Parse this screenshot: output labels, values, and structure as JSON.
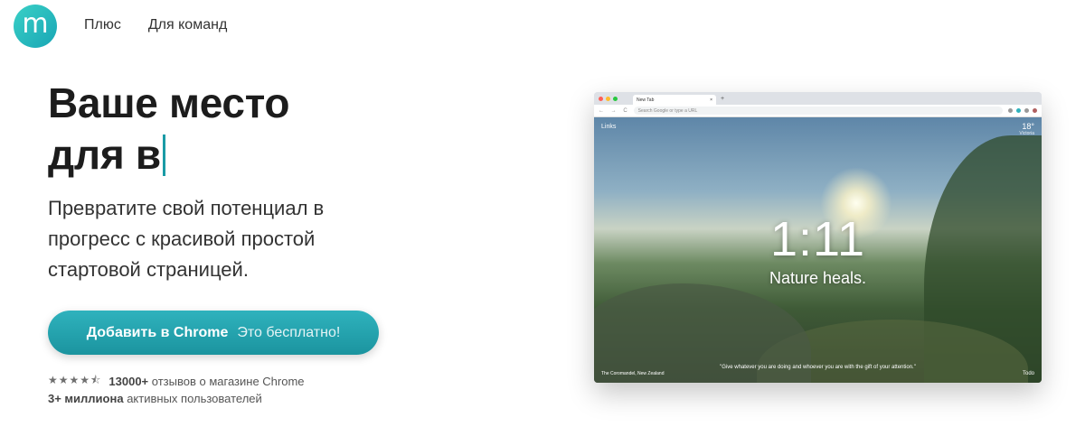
{
  "header": {
    "logo_letter": "m",
    "nav": [
      "Плюс",
      "Для команд"
    ]
  },
  "hero": {
    "headline_line1": "Ваше место",
    "headline_line2": "для в",
    "subtitle": "Превратите свой потенциал в прогресс с красивой простой стартовой страницей.",
    "cta_strong": "Добавить в Chrome",
    "cta_light": "Это бесплатно!",
    "stars": "★★★★⯪",
    "reviews_count": "13000+",
    "reviews_text": "отзывов о магазине Chrome",
    "users_count": "3+ миллиона",
    "users_text": "активных пользователей"
  },
  "browser": {
    "tab_title": "New Tab",
    "tab_close": "×",
    "new_tab": "+",
    "omnibox_placeholder": "Search Google or type a URL",
    "nav_icons": "← → C",
    "links_label": "Links",
    "weather_temp": "18°",
    "weather_location": "Victoria",
    "clock": "1:11",
    "mantra": "Nature heals.",
    "quote": "\"Give whatever you are doing and whoever you are with the gift of your attention.\"",
    "photo_location": "The Coromandel, New Zealand",
    "todo": "Todo"
  },
  "colors": {
    "accent": "#1a9ba6",
    "cta_top": "#2fb2bd",
    "cta_bottom": "#1b949f"
  }
}
